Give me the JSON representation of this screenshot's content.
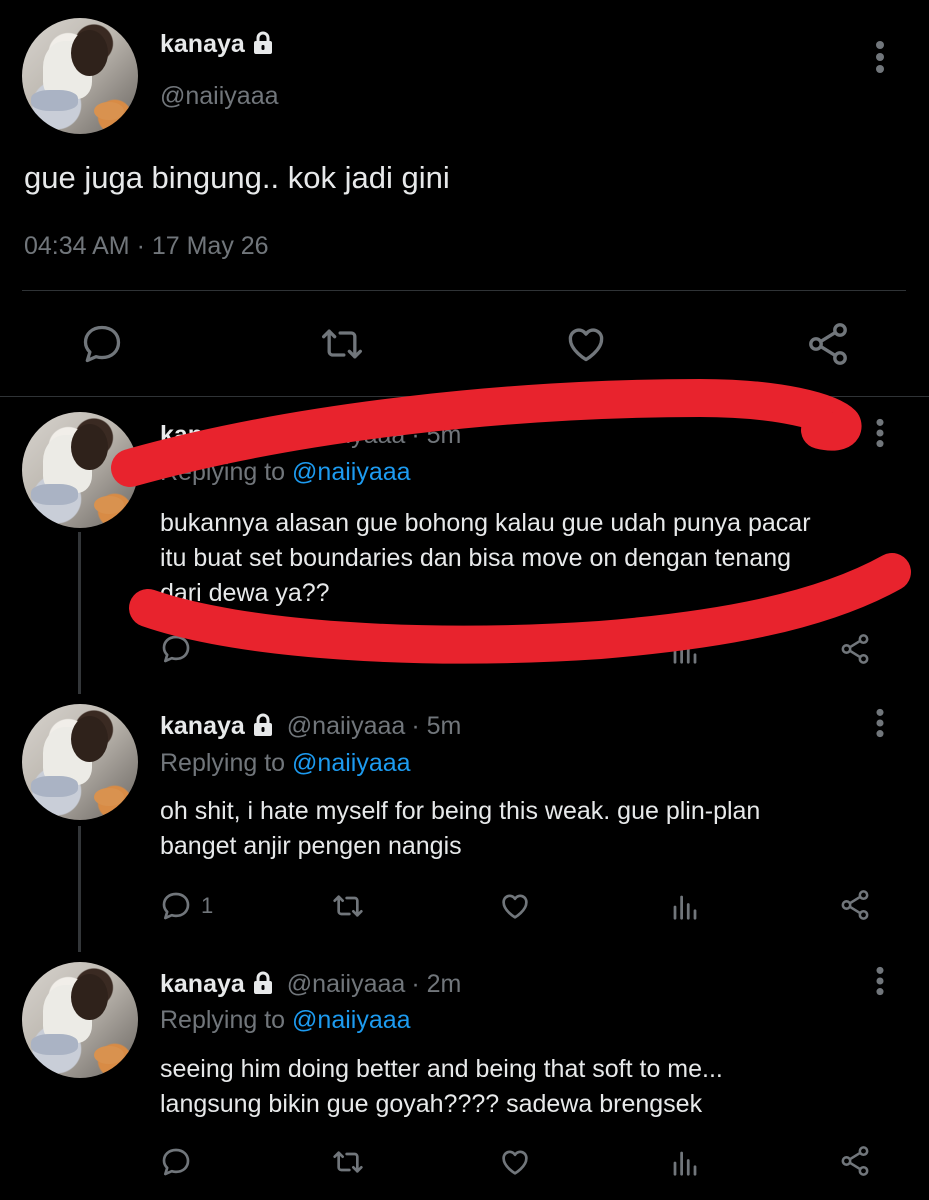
{
  "main_tweet": {
    "name": "kanaya",
    "handle": "@naiiyaaa",
    "text": "gue juga bingung.. kok jadi gini",
    "timestamp": "04:34 AM · 17 May 26"
  },
  "replies": [
    {
      "name": "kanaya",
      "handle": "@naiiyaaa",
      "time": "· 5m",
      "replying_prefix": "Replying to",
      "replying_to": "@naiiyaaa",
      "line1": "bukannya alasan gue bohong kalau gue udah punya pacar",
      "line2": "itu buat set boundaries dan bisa move on dengan tenang",
      "line3": "dari dewa ya??"
    },
    {
      "name": "kanaya",
      "handle": "@naiiyaaa",
      "time": "· 5m",
      "replying_prefix": "Replying to",
      "replying_to": "@naiiyaaa",
      "line1": "oh shit, i hate myself for being this weak. gue plin-plan",
      "line2": "banget anjir pengen nangis",
      "reply_count": "1"
    },
    {
      "name": "kanaya",
      "handle": "@naiiyaaa",
      "time": "· 2m",
      "replying_prefix": "Replying to",
      "replying_to": "@naiiyaaa",
      "line1": "seeing him doing better and being that soft to me...",
      "line2": "langsung bikin gue goyah???? sadewa brengsek"
    }
  ],
  "colors": {
    "background": "#000000",
    "text": "#e7e9ea",
    "muted": "#71767b",
    "link": "#1d9bf0",
    "scribble": "#e8232d"
  },
  "icons": [
    "lock-icon",
    "more-icon",
    "reply-icon",
    "retweet-icon",
    "like-icon",
    "share-icon",
    "analytics-icon"
  ]
}
